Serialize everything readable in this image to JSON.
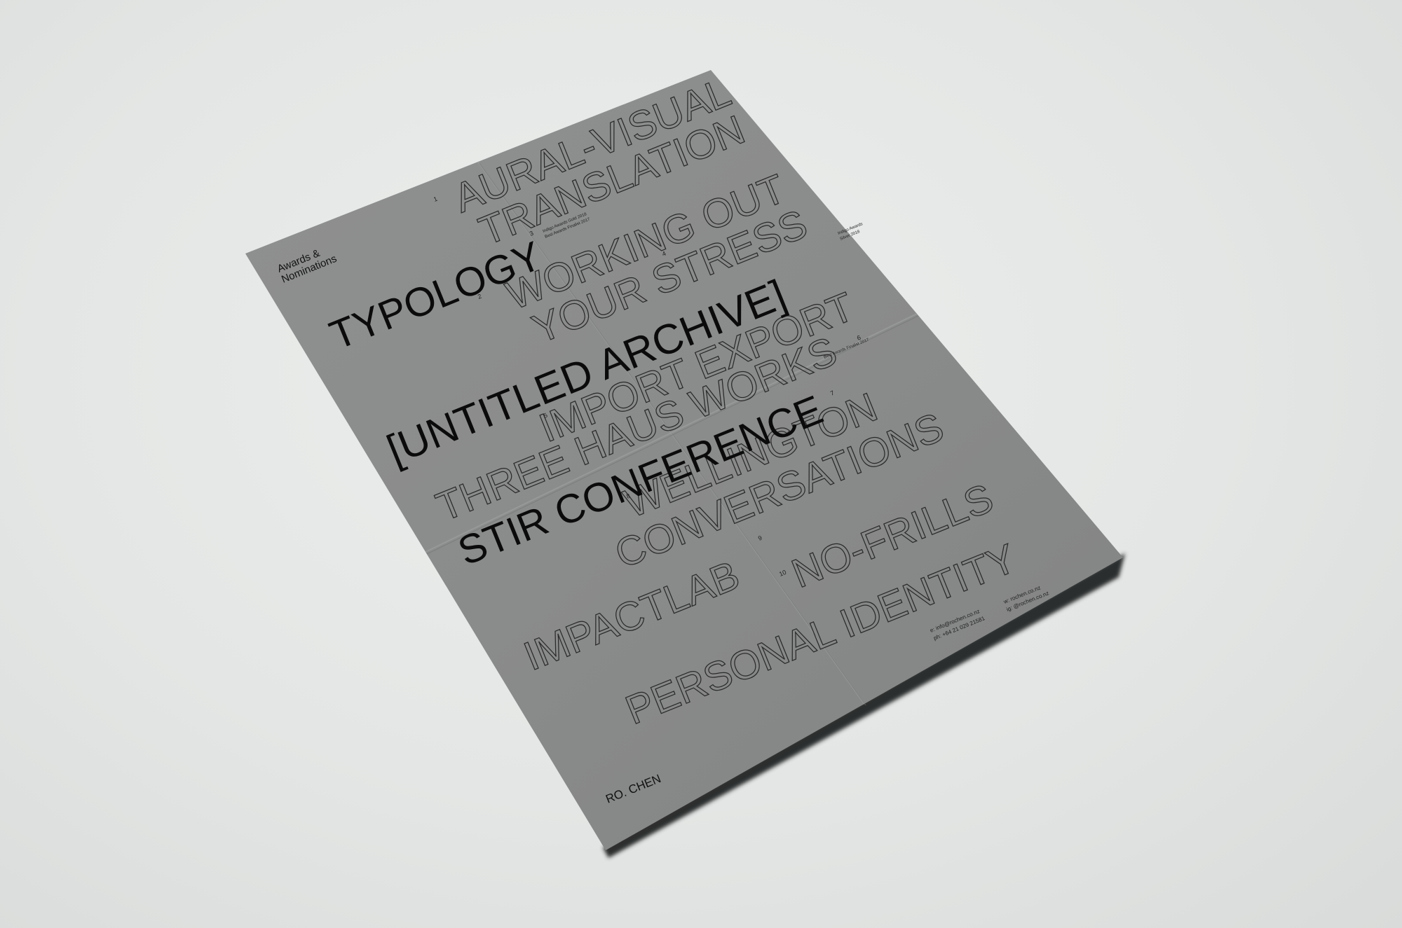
{
  "poster": {
    "heading_line1": "Awards &",
    "heading_line2": "Nominations",
    "footer_name": "RO. CHEN",
    "contact": {
      "email": "e: info@rochen.co.nz",
      "phone": "ph: +64 21 029 21581",
      "web": "w: rochen.co.nz",
      "instagram": "ig: @rochen.co.nz"
    },
    "entries": {
      "aural_visual": "AURAL-VISUAL",
      "translation": "TRANSLATION",
      "typology": "TYPOLOGY",
      "working_out": "WORKING OUT",
      "your_stress": "YOUR STRESS",
      "untitled_archive": "[UNTITLED ARCHIVE]",
      "import_export": "IMPORT EXPORT",
      "three_haus_works": "THREE HAUS WORKS",
      "stir_conference": "STIR CONFERENCE",
      "wellington": "WELLINGTON",
      "conversations": "CONVERSATIONS",
      "impactlab": "IMPACTLAB",
      "no_frills": "NO-FRILLS",
      "personal_identity": "PERSONAL IDENTITY"
    },
    "numbers": {
      "n1": "1",
      "n2": "2",
      "n3": "3",
      "n4": "4",
      "n5": "5",
      "n6": "6",
      "n7": "7",
      "n8": "8",
      "n9": "9",
      "n10": "10"
    },
    "award_notes": {
      "note_typology_1": "Indigo Awards Gold 2018",
      "note_typology_2": "Best Awards Finalist 2017",
      "note_archive_1": "Indigo Awards",
      "note_archive_2": "Silver 2018",
      "note_stir": "Best Awards Finalist 2017"
    }
  },
  "colors": {
    "paper": "#8a8b8b",
    "paper_light": "#979898",
    "ink": "#0b0b0b",
    "outline_ink": "#2a2a2a",
    "background": "#e6e8e7",
    "shadow": "#2b2c2c"
  }
}
